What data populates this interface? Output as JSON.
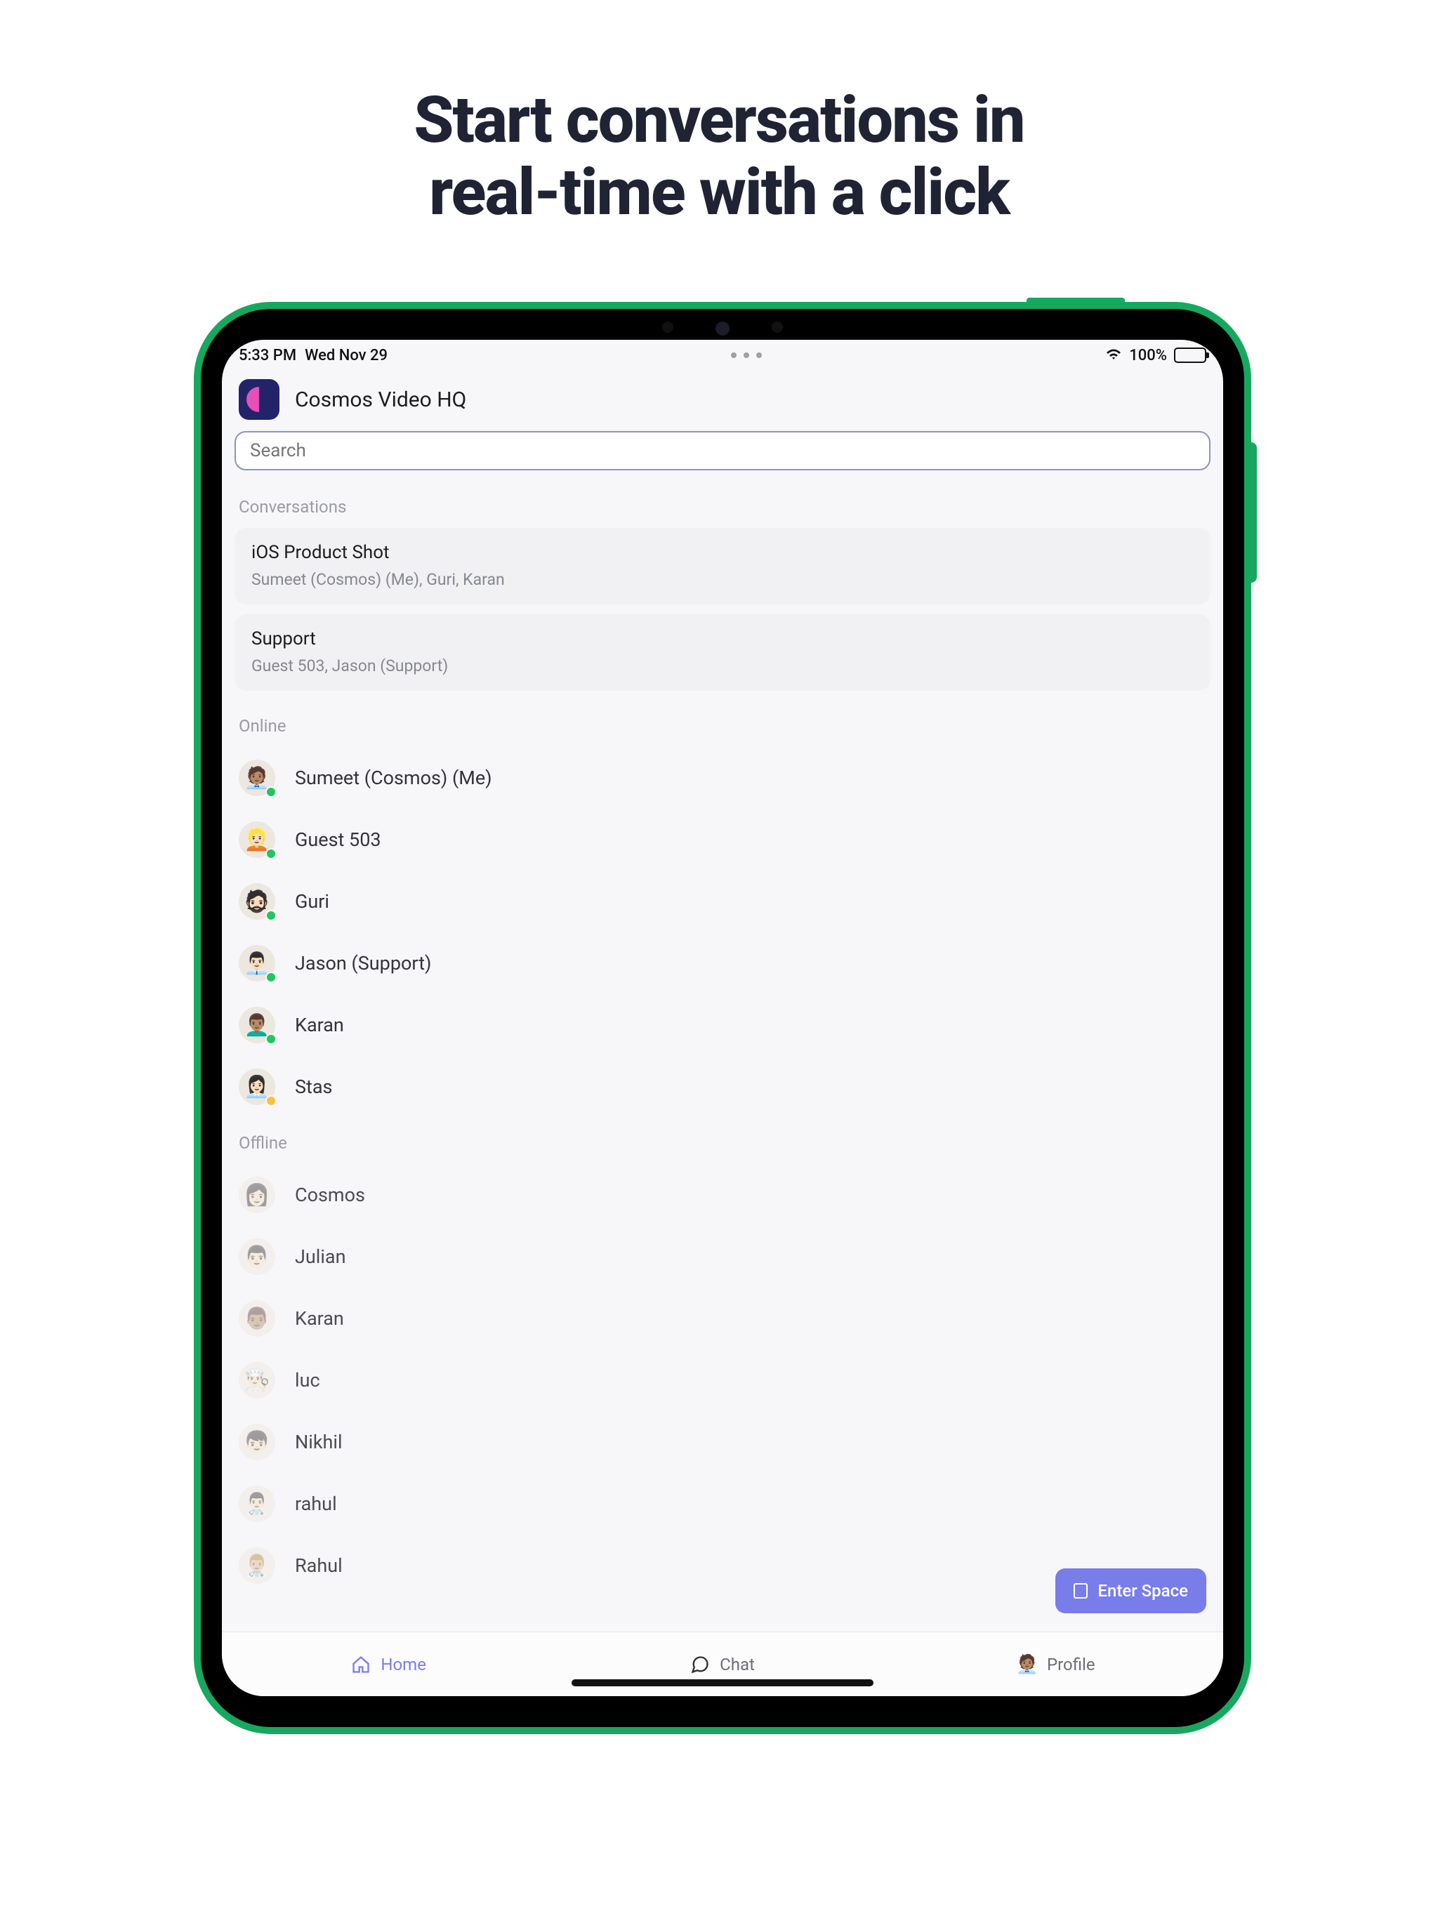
{
  "marketing": {
    "headline_line1": "Start conversations in",
    "headline_line2": "real-time with a click"
  },
  "statusbar": {
    "time": "5:33 PM",
    "date": "Wed Nov 29",
    "battery": "100%"
  },
  "header": {
    "app_title": "Cosmos Video HQ"
  },
  "search": {
    "placeholder": "Search"
  },
  "sections": {
    "conversations_label": "Conversations",
    "online_label": "Online",
    "offline_label": "Offline"
  },
  "conversations": [
    {
      "title": "iOS Product Shot",
      "members": "Sumeet (Cosmos) (Me), Guri, Karan"
    },
    {
      "title": "Support",
      "members": "Guest 503, Jason (Support)"
    }
  ],
  "online": [
    {
      "name": "Sumeet (Cosmos) (Me)",
      "emoji": "🧑🏽‍💼",
      "status": "online"
    },
    {
      "name": "Guest 503",
      "emoji": "👱🏻",
      "status": "online"
    },
    {
      "name": "Guri",
      "emoji": "🧔🏻",
      "status": "online"
    },
    {
      "name": "Jason (Support)",
      "emoji": "👨🏻‍💼",
      "status": "online"
    },
    {
      "name": "Karan",
      "emoji": "👨🏽‍🦱",
      "status": "online"
    },
    {
      "name": "Stas",
      "emoji": "👩🏻‍💼",
      "status": "away"
    }
  ],
  "offline": [
    {
      "name": "Cosmos",
      "emoji": "👩🏻"
    },
    {
      "name": "Julian",
      "emoji": "👨🏻"
    },
    {
      "name": "Karan",
      "emoji": "👨🏽"
    },
    {
      "name": "luc",
      "emoji": "👨🏻‍🍳"
    },
    {
      "name": "Nikhil",
      "emoji": "👦🏻"
    },
    {
      "name": "rahul",
      "emoji": "👨🏻‍⚕️"
    },
    {
      "name": "Rahul",
      "emoji": "👨🏼‍⚕️"
    }
  ],
  "enter_space": {
    "label": "Enter Space"
  },
  "tabs": {
    "home": "Home",
    "chat": "Chat",
    "profile": "Profile"
  }
}
